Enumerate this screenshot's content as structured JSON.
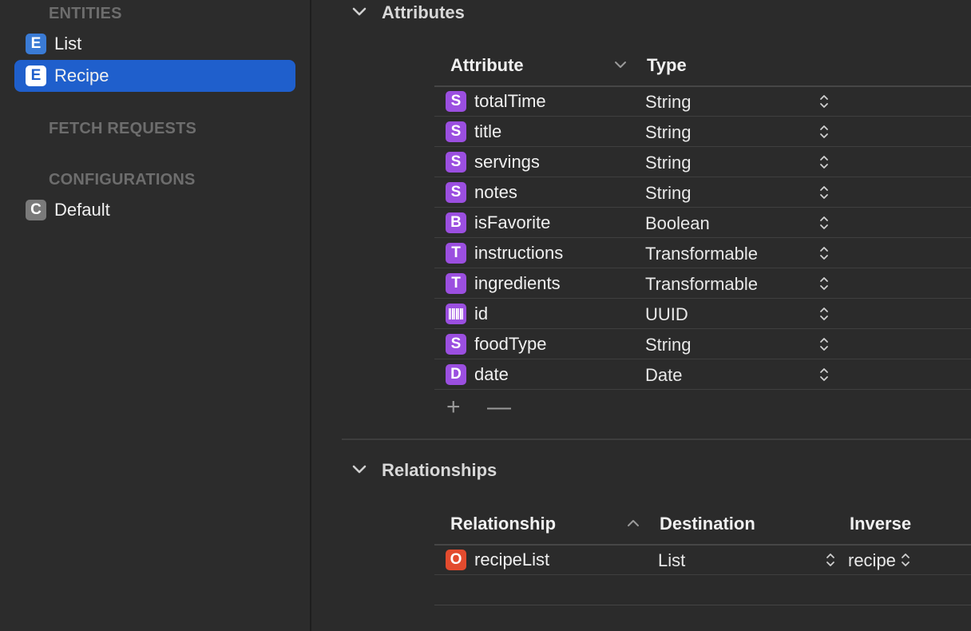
{
  "sidebar": {
    "entities_header": "ENTITIES",
    "entities": [
      {
        "badge": "E",
        "label": "List",
        "selected": false
      },
      {
        "badge": "E",
        "label": "Recipe",
        "selected": true
      }
    ],
    "fetch_header": "FETCH REQUESTS",
    "config_header": "CONFIGURATIONS",
    "configurations": [
      {
        "badge": "C",
        "label": "Default"
      }
    ]
  },
  "attributes": {
    "title": "Attributes",
    "col_attribute": "Attribute",
    "col_type": "Type",
    "rows": [
      {
        "badge": "S",
        "name": "totalTime",
        "type": "String"
      },
      {
        "badge": "S",
        "name": "title",
        "type": "String"
      },
      {
        "badge": "S",
        "name": "servings",
        "type": "String"
      },
      {
        "badge": "S",
        "name": "notes",
        "type": "String"
      },
      {
        "badge": "B",
        "name": "isFavorite",
        "type": "Boolean"
      },
      {
        "badge": "T",
        "name": "instructions",
        "type": "Transformable"
      },
      {
        "badge": "T",
        "name": "ingredients",
        "type": "Transformable"
      },
      {
        "badge": "barcode-icon",
        "name": "id",
        "type": "UUID"
      },
      {
        "badge": "S",
        "name": "foodType",
        "type": "String"
      },
      {
        "badge": "D",
        "name": "date",
        "type": "Date"
      }
    ],
    "add_label": "+",
    "remove_label": "—"
  },
  "relationships": {
    "title": "Relationships",
    "col_relationship": "Relationship",
    "col_destination": "Destination",
    "col_inverse": "Inverse",
    "rows": [
      {
        "badge": "O",
        "name": "recipeList",
        "destination": "List",
        "inverse": "recipe"
      }
    ]
  },
  "colors": {
    "selection": "#1f5fcc",
    "entity_badge": "#3a7bd5",
    "attribute_badge": "#9b4fe0",
    "relationship_badge": "#e34b2e",
    "config_badge": "#7a7a7a"
  }
}
